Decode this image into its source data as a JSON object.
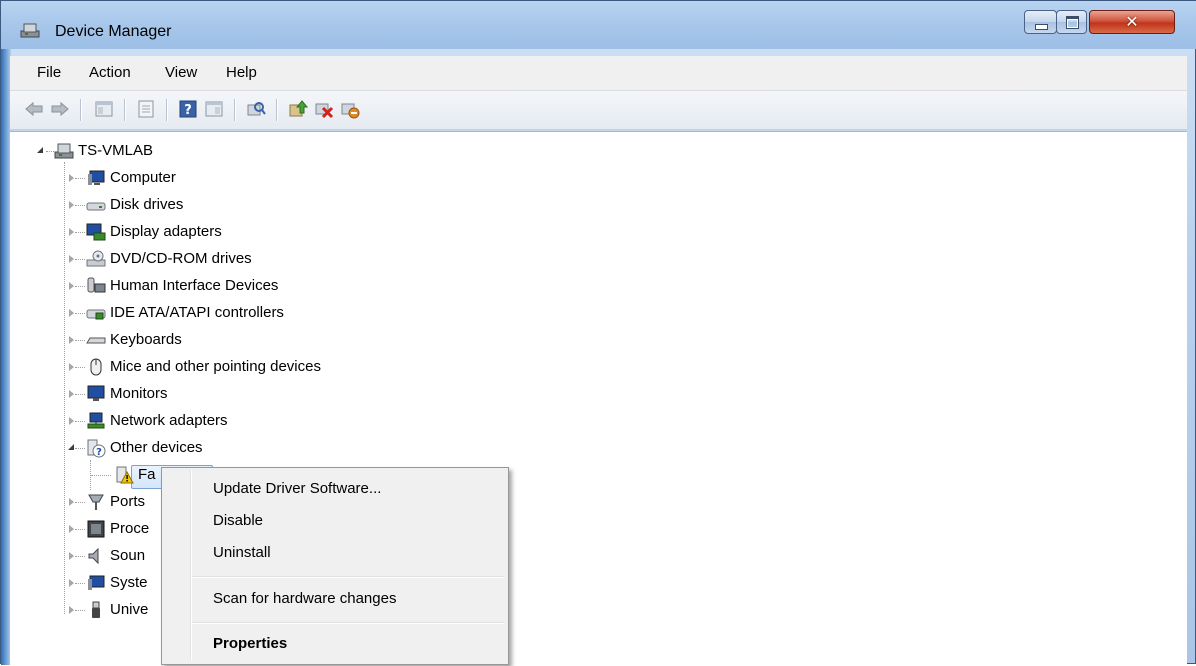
{
  "window": {
    "title": "Device Manager"
  },
  "menubar": {
    "items": [
      "File",
      "Action",
      "View",
      "Help"
    ]
  },
  "toolbar": {
    "buttons": [
      "back-arrow-icon",
      "forward-arrow-icon",
      "show-hide-console-tree-icon",
      "properties-icon",
      "help-icon",
      "action-pane-icon",
      "scan-hardware-icon",
      "update-driver-icon",
      "uninstall-icon",
      "disable-icon"
    ]
  },
  "tree": {
    "root": "TS-VMLAB",
    "categories": [
      {
        "label": "Computer"
      },
      {
        "label": "Disk drives"
      },
      {
        "label": "Display adapters"
      },
      {
        "label": "DVD/CD-ROM drives"
      },
      {
        "label": "Human Interface Devices"
      },
      {
        "label": "IDE ATA/ATAPI controllers"
      },
      {
        "label": "Keyboards"
      },
      {
        "label": "Mice and other pointing devices"
      },
      {
        "label": "Monitors"
      },
      {
        "label": "Network adapters"
      },
      {
        "label": "Other devices"
      },
      {
        "label": "Fa"
      },
      {
        "label": "Ports"
      },
      {
        "label": "Proce"
      },
      {
        "label": "Soun"
      },
      {
        "label": "Syste"
      },
      {
        "label": "Unive"
      }
    ]
  },
  "context_menu": {
    "update_driver": "Update Driver Software...",
    "disable": "Disable",
    "uninstall": "Uninstall",
    "scan": "Scan for hardware changes",
    "properties": "Properties"
  }
}
